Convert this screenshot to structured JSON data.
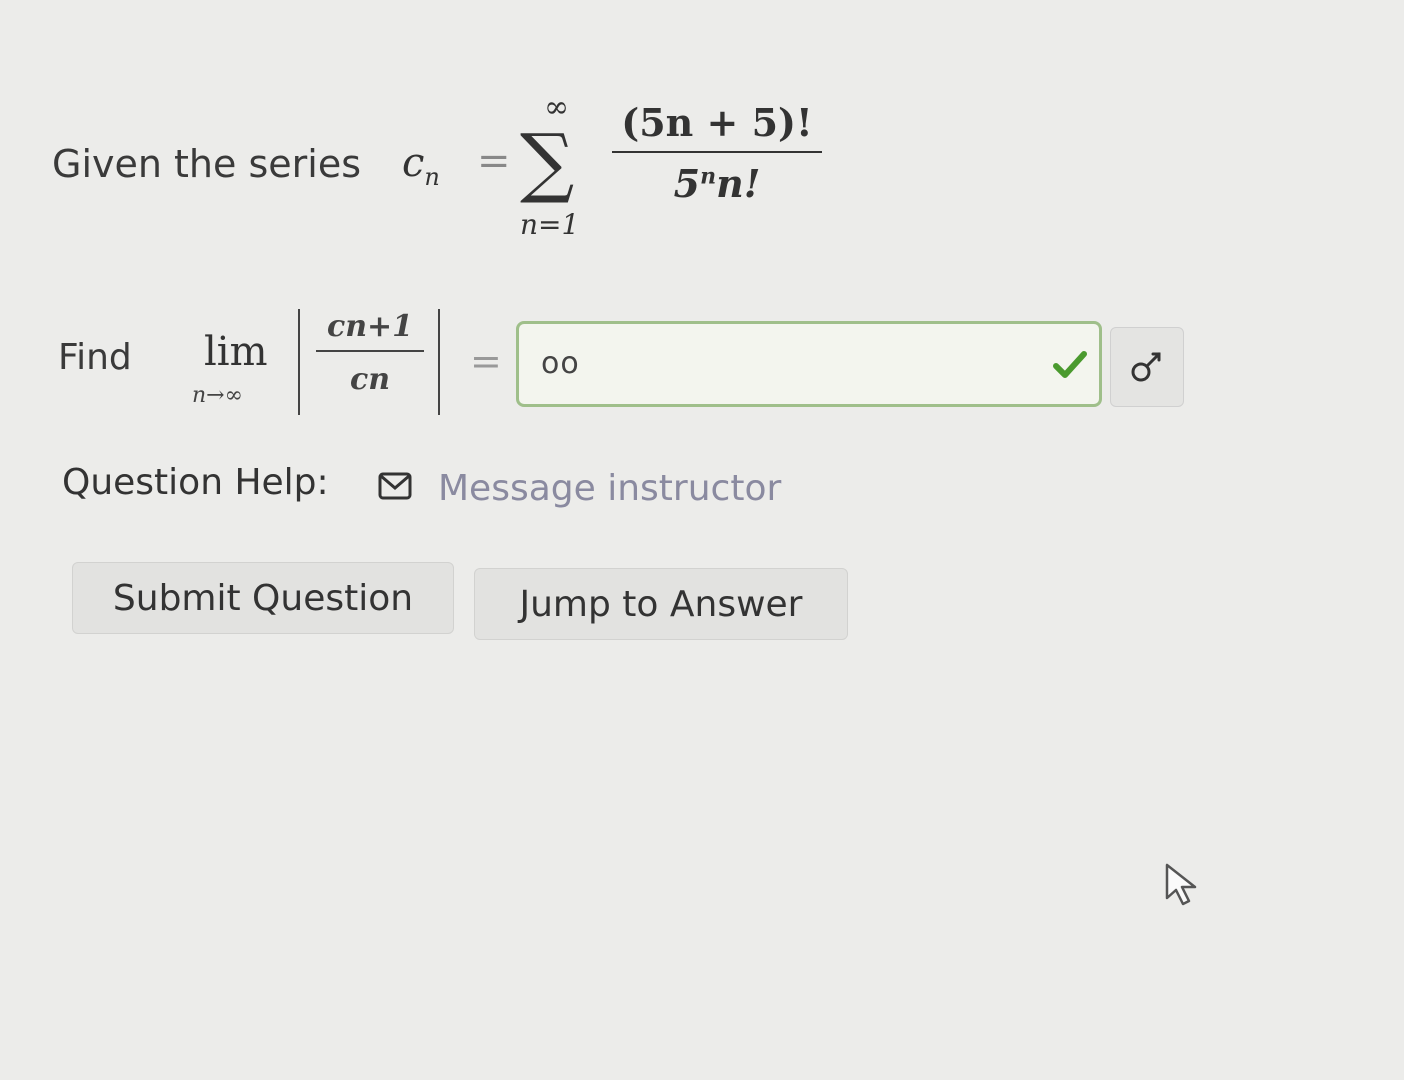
{
  "series": {
    "label": "Given the series",
    "var": "c",
    "var_sub": "n",
    "equals": "=",
    "sum_upper": "∞",
    "sum_symbol": "∑",
    "sum_lower": "n=1",
    "numerator": "(5n + 5)!",
    "denominator_base": "5",
    "denominator_exp": "n",
    "denominator_rest": "n!"
  },
  "limit": {
    "label": "Find",
    "lim": "lim",
    "lim_sub": "n→∞",
    "frac_num": "cn+1",
    "frac_den": "cn",
    "equals": "=",
    "answer_value": "oo",
    "answer_status": "correct"
  },
  "help": {
    "label": "Question Help:",
    "message_link": "Message instructor"
  },
  "buttons": {
    "submit": "Submit Question",
    "jump": "Jump to Answer"
  },
  "colors": {
    "correct_border": "#9fbf8a",
    "check_mark": "#4a9a2e",
    "link": "#8a8aa0"
  },
  "icons": [
    "check-icon",
    "key-icon",
    "mail-icon",
    "cursor-icon"
  ]
}
